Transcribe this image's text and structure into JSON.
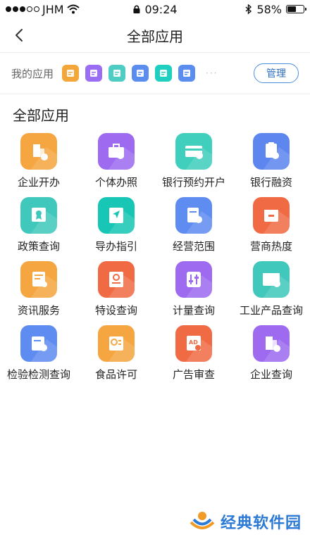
{
  "status_bar": {
    "carrier": "JHM",
    "time": "09:24",
    "battery": "58%",
    "battery_level": 0.58
  },
  "nav": {
    "title": "全部应用"
  },
  "my_apps": {
    "label": "我的应用",
    "manage_label": "管理",
    "more": "···",
    "icons": [
      {
        "name": "enterprise-mini-icon",
        "color": "#f3a73b"
      },
      {
        "name": "wallet-mini-icon",
        "color": "#9b6df2"
      },
      {
        "name": "card-mini-icon",
        "color": "#4ecdc4"
      },
      {
        "name": "doc-mini-icon",
        "color": "#5b8def"
      },
      {
        "name": "book-mini-icon",
        "color": "#1fcfc0"
      },
      {
        "name": "check-doc-mini-icon",
        "color": "#5b8def"
      }
    ]
  },
  "section": {
    "title": "全部应用"
  },
  "apps": [
    {
      "label": "企业开办",
      "icon": "building-icon",
      "color": "#f5a640"
    },
    {
      "label": "个体办照",
      "icon": "briefcase-icon",
      "color": "#9d6af0"
    },
    {
      "label": "银行预约开户",
      "icon": "bank-card-icon",
      "color": "#3fcfbc"
    },
    {
      "label": "银行融资",
      "icon": "yen-doc-icon",
      "color": "#5d86ef"
    },
    {
      "label": "政策查询",
      "icon": "certificate-icon",
      "color": "#3fc8bb"
    },
    {
      "label": "导办指引",
      "icon": "send-book-icon",
      "color": "#17c6b4"
    },
    {
      "label": "经营范围",
      "icon": "search-doc-icon",
      "color": "#5f8cf0"
    },
    {
      "label": "营商热度",
      "icon": "shop-icon",
      "color": "#f06a43"
    },
    {
      "label": "资讯服务",
      "icon": "news-icon",
      "color": "#f5a640"
    },
    {
      "label": "特设查询",
      "icon": "special-search-icon",
      "color": "#f06a43"
    },
    {
      "label": "计量查询",
      "icon": "measure-icon",
      "color": "#9d6af0"
    },
    {
      "label": "工业产品查询",
      "icon": "industrial-icon",
      "color": "#3fc8bb"
    },
    {
      "label": "检验检测查询",
      "icon": "inspection-icon",
      "color": "#5f8cf0"
    },
    {
      "label": "食品许可",
      "icon": "food-icon",
      "color": "#f5a640"
    },
    {
      "label": "广告审查",
      "icon": "ad-icon",
      "color": "#f06a43"
    },
    {
      "label": "企业查询",
      "icon": "company-search-icon",
      "color": "#9d6af0"
    }
  ],
  "watermark": {
    "text": "经典软件园"
  }
}
